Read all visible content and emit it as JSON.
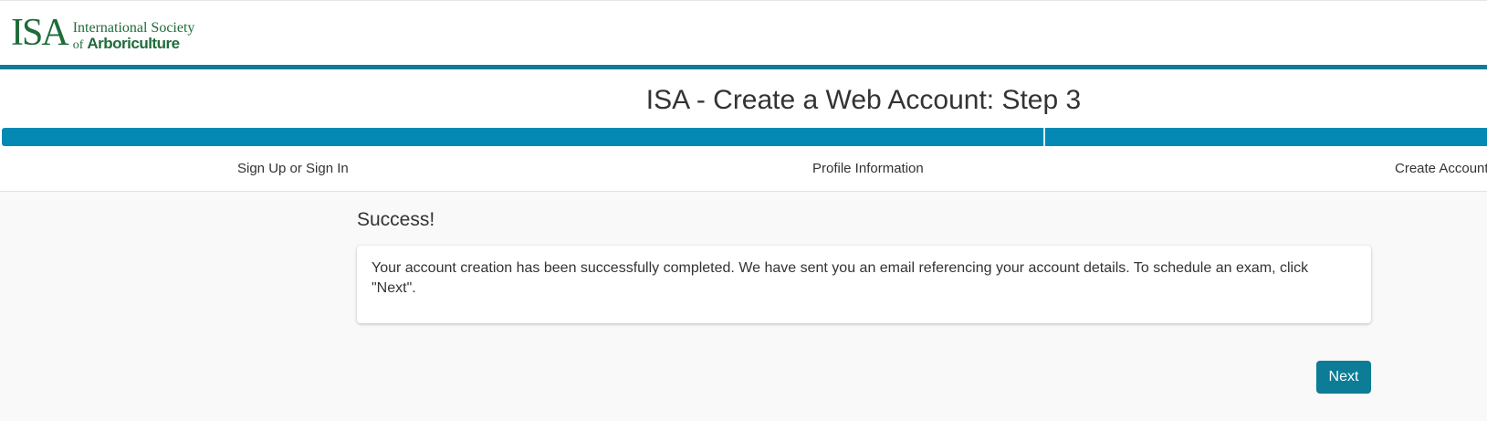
{
  "header": {
    "logo": {
      "mark": "ISA",
      "line1": "International Society",
      "line2_of": "of",
      "line2_name": "Arboriculture"
    }
  },
  "wizard": {
    "title": "ISA - Create a Web Account: Step 3",
    "progress_percent": 100,
    "steps": [
      {
        "label": "Sign Up or Sign In"
      },
      {
        "label": "Profile Information"
      },
      {
        "label": "Create Account"
      }
    ]
  },
  "main": {
    "heading": "Success!",
    "message": "Your account creation has been successfully completed. We have sent you an email referencing your account details. To schedule an exam, click \"Next\".",
    "next_label": "Next"
  },
  "colors": {
    "brand_green": "#1f6b3a",
    "accent_teal": "#0c7c97",
    "progress_blue": "#0389b4",
    "page_background": "#f9f9f9"
  }
}
